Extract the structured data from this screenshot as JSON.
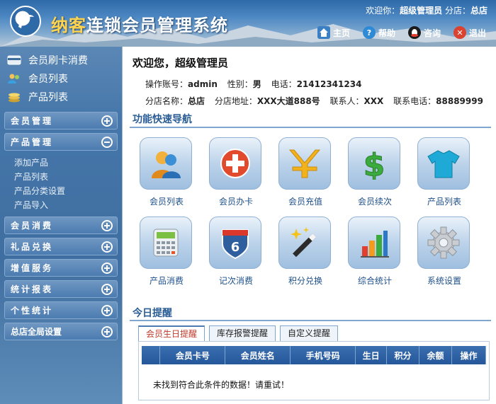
{
  "header": {
    "brand": "纳客",
    "title": "连锁会员管理系统",
    "welcome_prefix": "欢迎你：",
    "user": "超级管理员",
    "branch_prefix": "分店：",
    "branch": "总店",
    "nav": [
      {
        "label": "主页",
        "icon": "home-icon",
        "color": "#3b7fc4"
      },
      {
        "label": "帮助",
        "icon": "help-icon",
        "color": "#2f8ad6"
      },
      {
        "label": "咨询",
        "icon": "qq-icon",
        "color": "#1b1b1b"
      },
      {
        "label": "退出",
        "icon": "exit-icon",
        "color": "#d9432f"
      }
    ]
  },
  "sidebar": {
    "quick": [
      {
        "label": "会员刷卡消费",
        "icon": "card-icon"
      },
      {
        "label": "会员列表",
        "icon": "users-icon"
      },
      {
        "label": "产品列表",
        "icon": "coins-icon"
      }
    ],
    "menu": [
      {
        "label": "会员管理",
        "state": "plus"
      },
      {
        "label": "产品管理",
        "state": "minus",
        "sub": [
          "添加产品",
          "产品列表",
          "产品分类设置",
          "产品导入"
        ]
      },
      {
        "label": "会员消费",
        "state": "plus"
      },
      {
        "label": "礼品兑换",
        "state": "plus"
      },
      {
        "label": "增值服务",
        "state": "plus"
      },
      {
        "label": "统计报表",
        "state": "plus"
      },
      {
        "label": "个性统计",
        "state": "plus"
      },
      {
        "label": "总店全局设置",
        "state": "plus"
      }
    ]
  },
  "main": {
    "greeting": "欢迎您，超级管理员",
    "account_label": "操作账号：",
    "account": "admin",
    "gender_label": "性别：",
    "gender": "男",
    "phone_label": "电话：",
    "phone": "21412341234",
    "branch_label": "分店名称：",
    "branch": "总店",
    "address_label": "分店地址：",
    "address": "XXX大道888号",
    "contact_label": "联系人：",
    "contact": "XXX",
    "contact_phone_label": "联系电话：",
    "contact_phone": "88889999",
    "nav_title": "功能快速导航",
    "tiles": [
      {
        "label": "会员列表",
        "icon": "member-list-icon"
      },
      {
        "label": "会员办卡",
        "icon": "add-card-icon"
      },
      {
        "label": "会员充值",
        "icon": "yen-icon"
      },
      {
        "label": "会员续次",
        "icon": "dollar-icon"
      },
      {
        "label": "产品列表",
        "icon": "tshirt-icon"
      },
      {
        "label": "产品消费",
        "icon": "calculator-icon"
      },
      {
        "label": "记次消费",
        "icon": "count-badge-icon"
      },
      {
        "label": "积分兑换",
        "icon": "magic-wand-icon"
      },
      {
        "label": "综合统计",
        "icon": "bar-chart-icon"
      },
      {
        "label": "系统设置",
        "icon": "gear-icon"
      }
    ],
    "reminder_title": "今日提醒",
    "tabs": [
      "会员生日提醒",
      "库存报警提醒",
      "自定义提醒"
    ],
    "table_headers": [
      "会员卡号",
      "会员姓名",
      "手机号码",
      "生日",
      "积分",
      "余额",
      "操作"
    ],
    "empty_message": "未找到符合此条件的数据！请重试！",
    "badge_number": "6"
  }
}
